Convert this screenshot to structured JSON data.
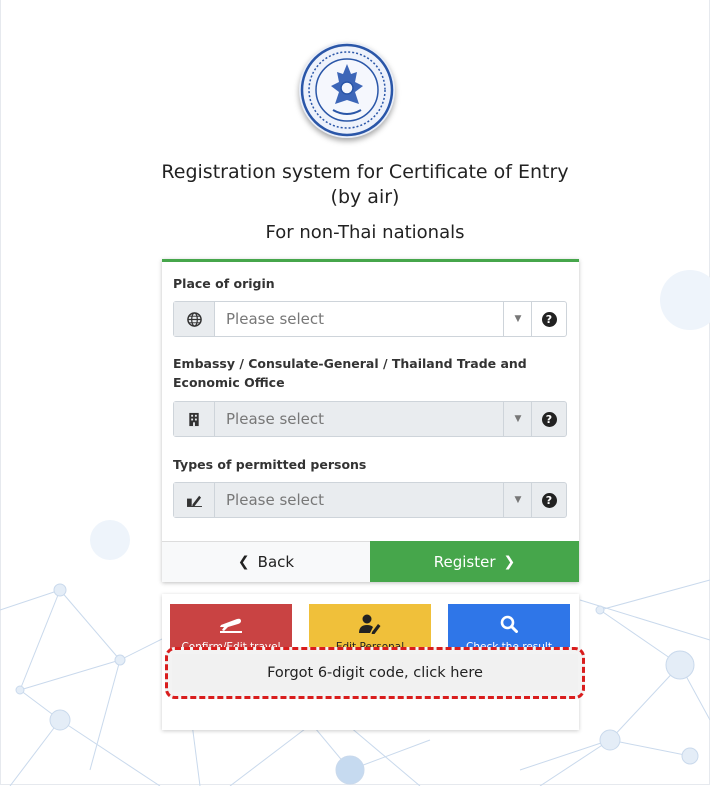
{
  "header": {
    "logo_name": "Thai MFA seal emblem",
    "title": "Registration system for Certificate of Entry (by air)",
    "subtitle": "For non-Thai nationals"
  },
  "form": {
    "origin": {
      "label": "Place of origin",
      "placeholder": "Please select",
      "icon": "globe-icon"
    },
    "embassy": {
      "label": "Embassy / Consulate-General / Thailand Trade and Economic Office",
      "placeholder": "Please select",
      "icon": "building-icon"
    },
    "person_type": {
      "label": "Types of permitted persons",
      "placeholder": "Please select",
      "icon": "signature-icon"
    },
    "back_label": "Back",
    "register_label": "Register"
  },
  "quick_actions": [
    {
      "label": "Confirm/Edit travel",
      "icon": "plane-icon",
      "color": "#c94343"
    },
    {
      "label": "Edit Personal information",
      "icon": "user-edit-icon",
      "color": "#f0c03a"
    },
    {
      "label": "Check the result",
      "icon": "search-icon",
      "color": "#2f76e8"
    }
  ],
  "forgot_code_label": "Forgot 6-digit code, click here",
  "colors": {
    "accent_green": "#46a64b",
    "highlight_dashed": "#d91d1d"
  }
}
